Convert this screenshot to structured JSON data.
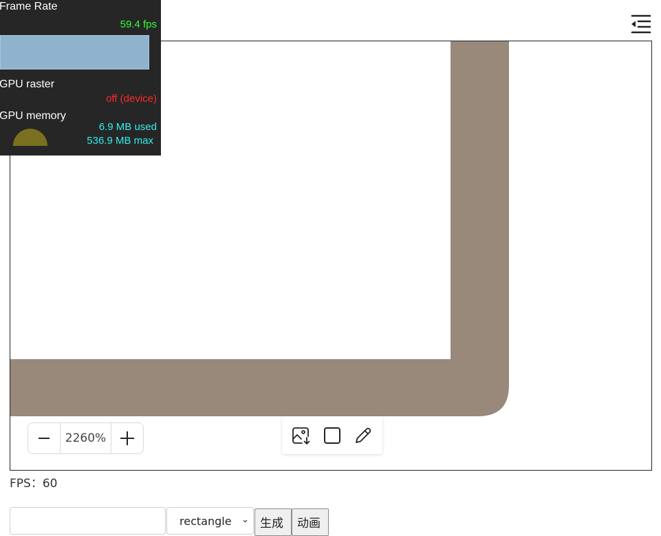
{
  "stats": {
    "frame_rate_label": "Frame Rate",
    "frame_rate_value": "59.4 fps",
    "gpu_raster_label": "GPU raster",
    "gpu_raster_value": "off (device)",
    "gpu_memory_label": "GPU memory",
    "gpu_memory_used": "6.9 MB used",
    "gpu_memory_max": "536.9 MB max",
    "gpu_memory_fraction": 0.013,
    "colors": {
      "background": "#262626",
      "fps": "#33ff33",
      "raster": "#ff2a2a",
      "memory": "#33eeee",
      "graph": "#8fb3cd"
    }
  },
  "header": {
    "menu_icon": "indent-left-icon"
  },
  "canvas": {
    "shape_fill": "#98897a",
    "background": "#ffffff"
  },
  "zoom": {
    "minus_icon": "minus-icon",
    "value": "2260%",
    "plus_icon": "plus-icon"
  },
  "toolbar": {
    "tools": [
      "image-download-icon",
      "rectangle-icon",
      "pencil-icon"
    ]
  },
  "fps_label": "FPS：60",
  "controls": {
    "text_input_value": "",
    "shape_select_value": "rectangle",
    "generate_label": "生成",
    "animate_label": "动画"
  }
}
